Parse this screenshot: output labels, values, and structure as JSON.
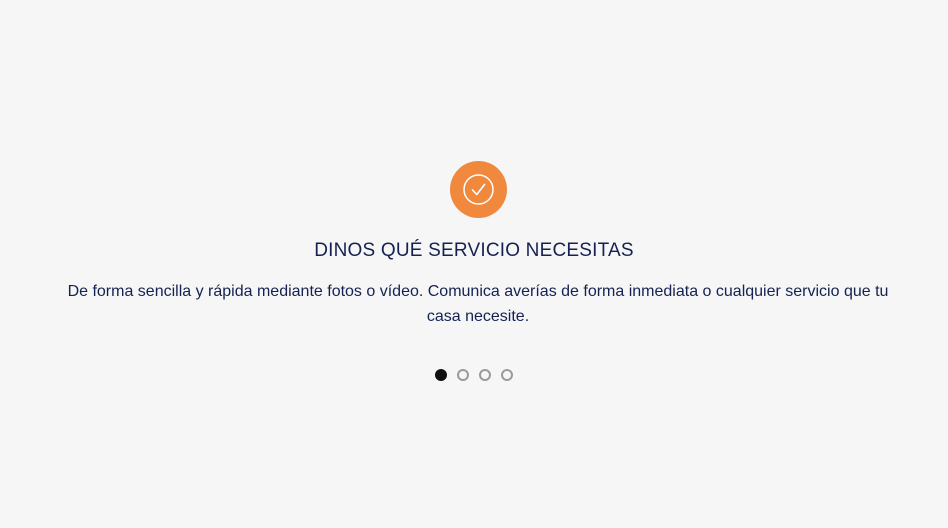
{
  "slide": {
    "icon": "check-circle-icon",
    "title": "DINOS QUÉ SERVICIO NECESITAS",
    "description": "De forma sencilla y rápida mediante fotos o vídeo. Comunica averías de forma inmediata o cualquier servicio que tu casa necesite."
  },
  "pagination": {
    "total": 4,
    "active_index": 0
  },
  "colors": {
    "background": "#f6f6f7",
    "accent": "#f0883e",
    "text": "#152251",
    "dot_active": "#111111",
    "dot_inactive": "#9a9a9a"
  }
}
